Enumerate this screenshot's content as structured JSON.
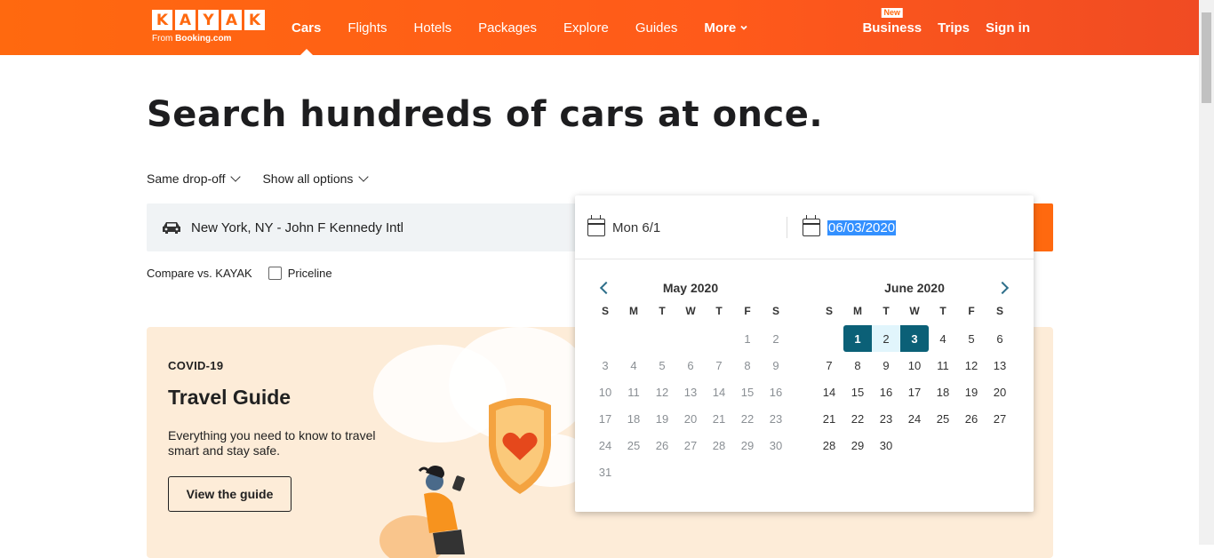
{
  "header": {
    "logo_letters": [
      "K",
      "A",
      "Y",
      "A",
      "K"
    ],
    "logo_sub_prefix": "From ",
    "logo_sub_brand": "Booking.com",
    "nav": [
      {
        "label": "Cars",
        "active": true
      },
      {
        "label": "Flights"
      },
      {
        "label": "Hotels"
      },
      {
        "label": "Packages"
      },
      {
        "label": "Explore"
      },
      {
        "label": "Guides"
      },
      {
        "label": "More"
      }
    ],
    "business_label": "Business",
    "business_badge": "New",
    "trips_label": "Trips",
    "signin_label": "Sign in"
  },
  "main": {
    "title": "Search hundreds of cars at once.",
    "option_dropoff": "Same drop-off",
    "option_show": "Show all options",
    "pickup_location": "New York, NY - John F Kennedy Intl",
    "compare_label": "Compare vs. KAYAK",
    "priceline_label": "Priceline"
  },
  "promo": {
    "tag": "COVID-19",
    "title": "Travel Guide",
    "desc": "Everything you need to know to travel smart and stay safe.",
    "button": "View the guide"
  },
  "datepicker": {
    "start_date": "Mon 6/1",
    "end_date": "06/03/2020",
    "weekdays": [
      "S",
      "M",
      "T",
      "W",
      "T",
      "F",
      "S"
    ],
    "months": [
      {
        "title": "May 2020",
        "offset": 5,
        "days": 31
      },
      {
        "title": "June 2020",
        "offset": 1,
        "days": 30
      }
    ]
  },
  "colors": {
    "brand": "#ff690f",
    "selected": "#0b6077",
    "range": "#e1f5fc"
  }
}
